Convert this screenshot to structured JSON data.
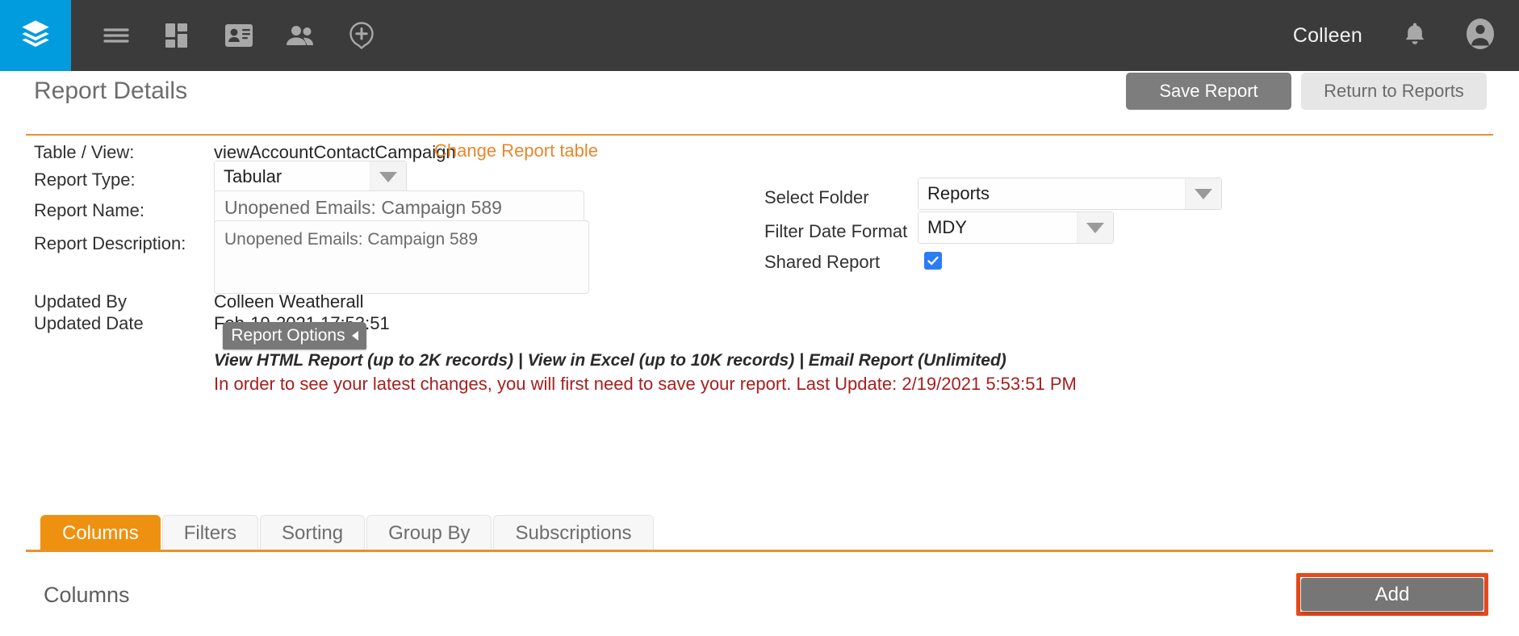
{
  "topnav": {
    "logo_icon": "layers-icon",
    "items": [
      {
        "icon": "hamburger-menu-icon",
        "name": "menu"
      },
      {
        "icon": "dashboard-grid-icon",
        "name": "dashboard"
      },
      {
        "icon": "contact-card-icon",
        "name": "contacts"
      },
      {
        "icon": "people-icon",
        "name": "people"
      },
      {
        "icon": "add-circle-icon",
        "name": "add"
      }
    ],
    "user_name": "Colleen",
    "bell_icon": "bell-icon",
    "avatar_icon": "user-avatar-icon"
  },
  "header": {
    "title": "Report Details",
    "save_label": "Save Report",
    "return_label": "Return to Reports"
  },
  "form": {
    "table_view_label": "Table / View:",
    "table_view_value": "viewAccountContactCampaign",
    "change_table_link": "Change Report table",
    "report_type_label": "Report Type:",
    "report_type_value": "Tabular",
    "report_name_label": "Report Name:",
    "report_name_value": "Unopened Emails: Campaign 589",
    "report_name_placeholder": "Unopened Emails: Campaign 589",
    "report_description_label": "Report Description:",
    "report_description_value": "Unopened Emails: Campaign 589",
    "report_description_placeholder": "Unopened Emails: Campaign 589",
    "updated_by_label": "Updated By",
    "updated_by_value": "Colleen Weatherall",
    "updated_date_label": "Updated Date",
    "updated_date_value": "Feb-19-2021 17:53:51",
    "report_options_label": "Report Options",
    "links": {
      "view_html": "View HTML Report (up to 2K records)",
      "sep1": " | ",
      "view_excel": "View in Excel (up to 10K records)",
      "sep2": " | ",
      "email_report": "Email Report (Unlimited)"
    },
    "warning": "In order to see your latest changes, you will first need to save your report. Last Update: 2/19/2021 5:53:51 PM",
    "select_folder_label": "Select Folder",
    "select_folder_value": "Reports",
    "filter_date_format_label": "Filter Date Format",
    "filter_date_format_value": "MDY",
    "shared_report_label": "Shared Report",
    "shared_report_checked": true
  },
  "tabs": [
    {
      "label": "Columns",
      "active": true
    },
    {
      "label": "Filters",
      "active": false
    },
    {
      "label": "Sorting",
      "active": false
    },
    {
      "label": "Group By",
      "active": false
    },
    {
      "label": "Subscriptions",
      "active": false
    }
  ],
  "section": {
    "title": "Columns",
    "add_label": "Add"
  },
  "colors": {
    "brand_blue": "#019cdd",
    "navbar": "#3b3b3b",
    "accent_orange": "#e8922f",
    "tab_active": "#ef9110",
    "warning_red": "#a81e1e",
    "highlight_red": "#e8491c",
    "checkbox_blue": "#2b7cf6"
  }
}
